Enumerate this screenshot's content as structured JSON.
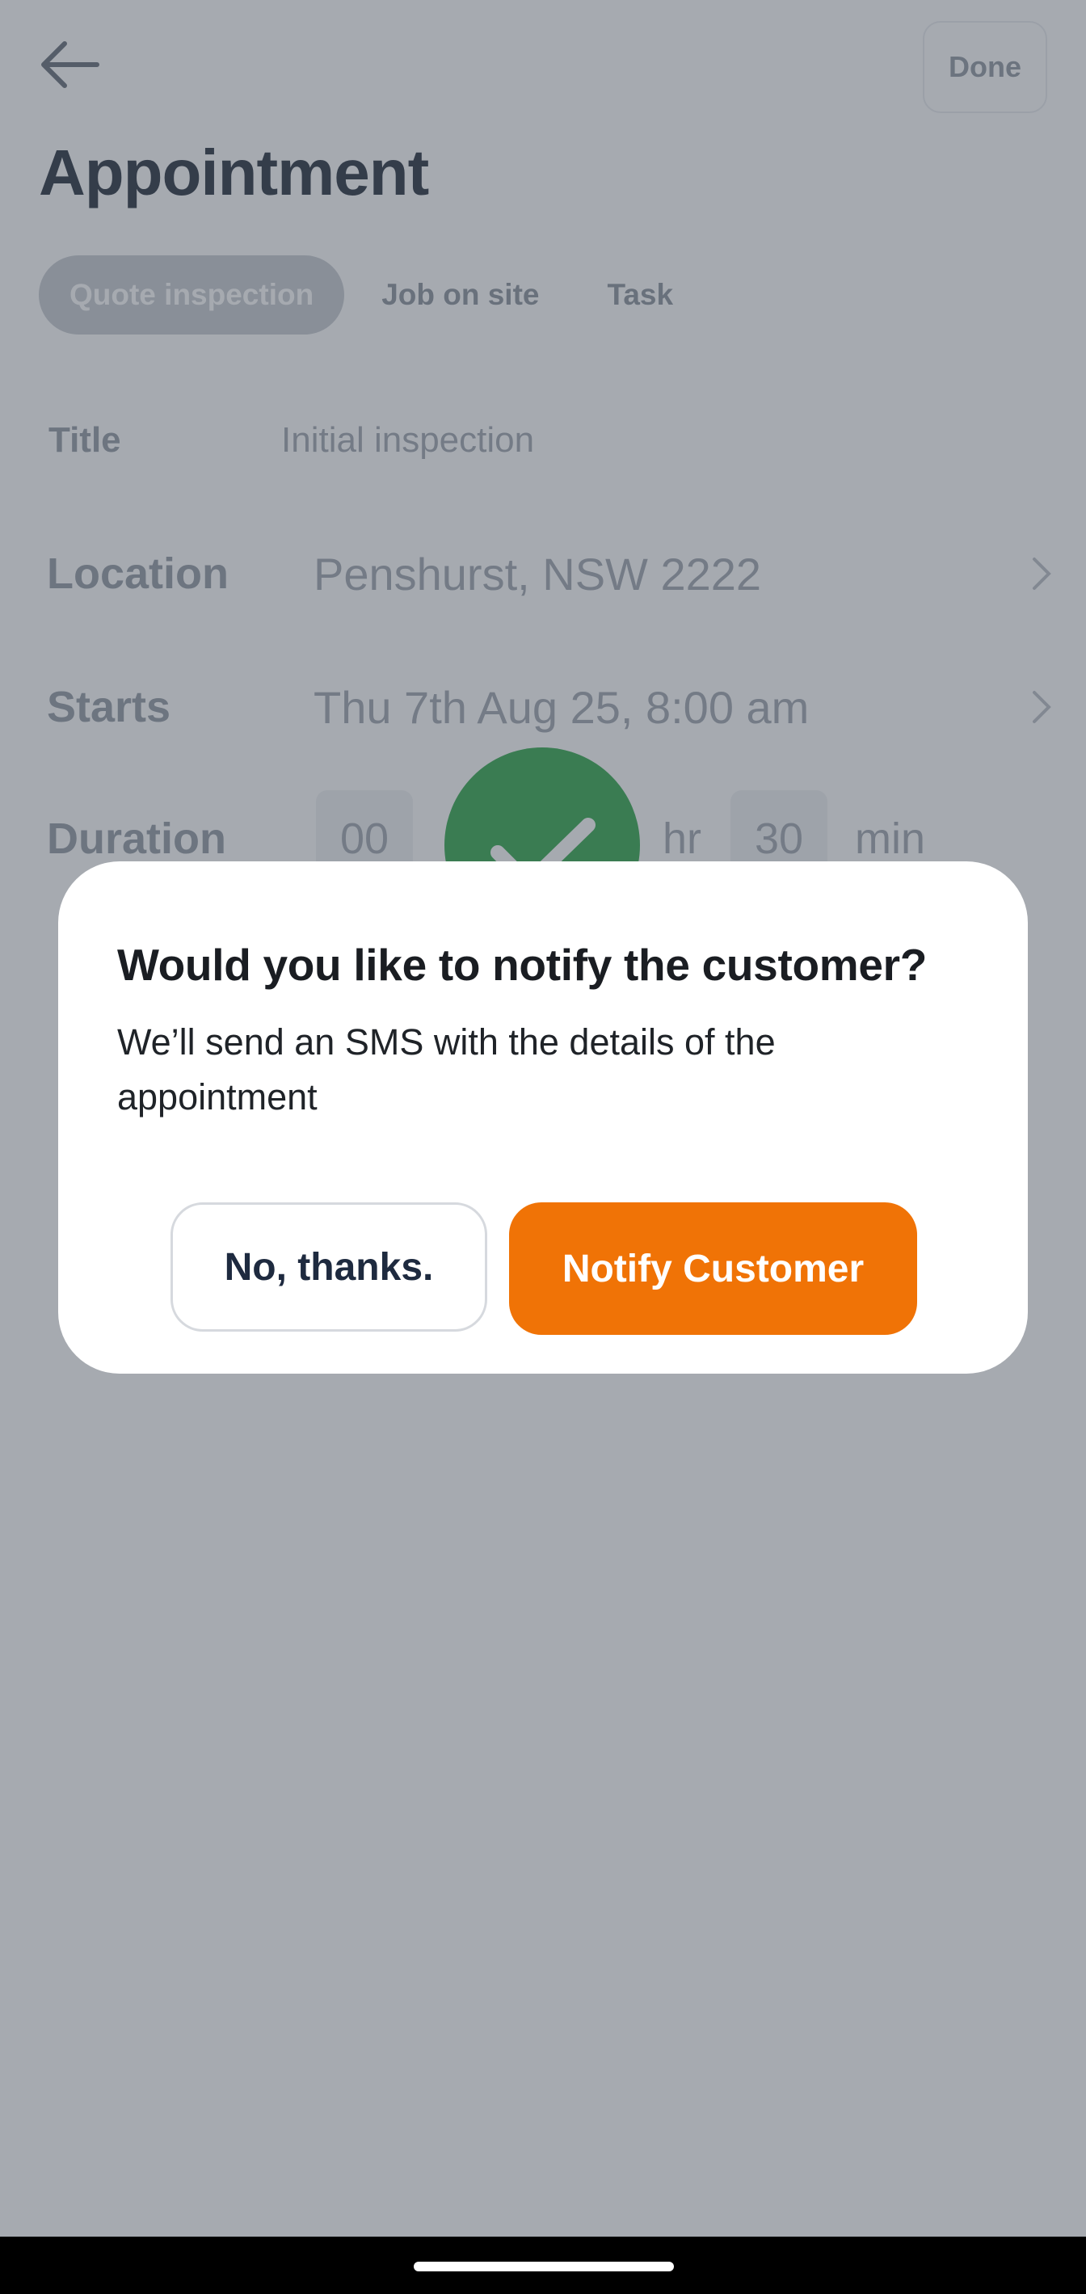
{
  "header": {
    "back_icon": "arrow-left-icon",
    "done_label": "Done",
    "title": "Appointment"
  },
  "tabs": [
    {
      "label": "Quote inspection",
      "active": true
    },
    {
      "label": "Job on site",
      "active": false
    },
    {
      "label": "Task",
      "active": false
    }
  ],
  "form": {
    "title": {
      "label": "Title",
      "placeholder": "Initial inspection"
    },
    "location": {
      "label": "Location",
      "value": "Penshurst, NSW 2222"
    },
    "starts": {
      "label": "Starts",
      "value": "Thu 7th Aug 25, 8:00 am"
    },
    "duration": {
      "label": "Duration",
      "hours": "00",
      "hours_unit": "hr",
      "minutes": "30",
      "minutes_unit": "min"
    }
  },
  "dialog": {
    "title": "Would you like to notify the customer?",
    "body": "We’ll send an SMS with the details of the appointment",
    "no_label": "No, thanks.",
    "notify_label": "Notify Customer"
  },
  "colors": {
    "accent": "#f07306",
    "success": "#27a243",
    "overlay": "#4e5662"
  }
}
